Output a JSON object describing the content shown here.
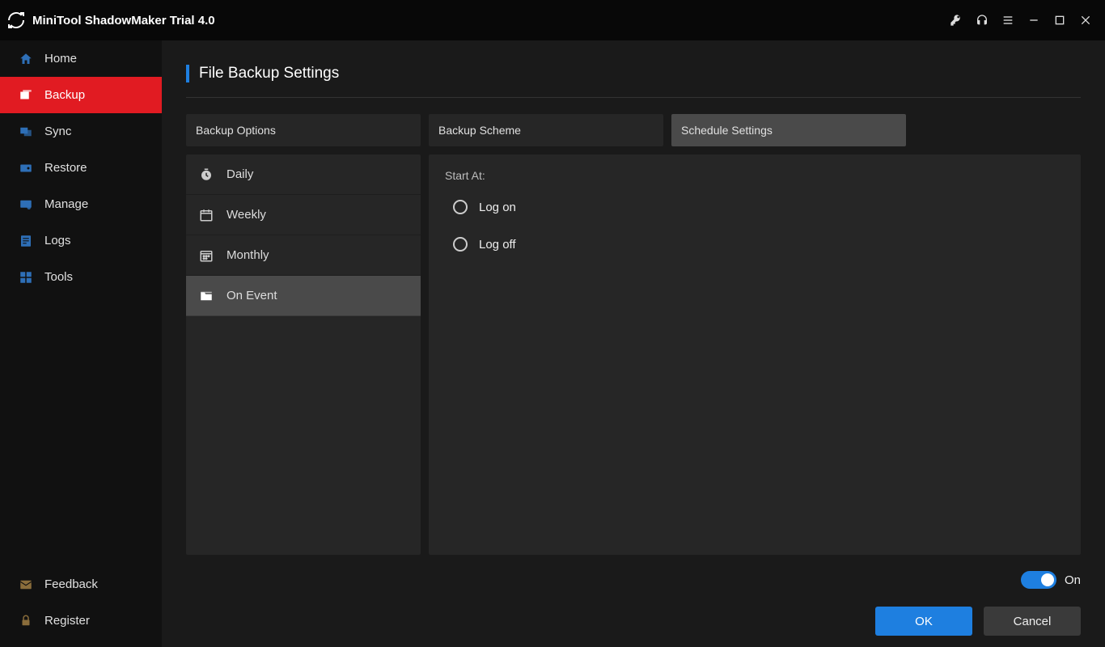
{
  "app": {
    "title": "MiniTool ShadowMaker Trial 4.0"
  },
  "sidebar": {
    "items": [
      {
        "label": "Home"
      },
      {
        "label": "Backup"
      },
      {
        "label": "Sync"
      },
      {
        "label": "Restore"
      },
      {
        "label": "Manage"
      },
      {
        "label": "Logs"
      },
      {
        "label": "Tools"
      }
    ],
    "bottom": [
      {
        "label": "Feedback"
      },
      {
        "label": "Register"
      }
    ]
  },
  "page": {
    "title": "File Backup Settings"
  },
  "tabs": [
    {
      "label": "Backup Options"
    },
    {
      "label": "Backup Scheme"
    },
    {
      "label": "Schedule Settings"
    }
  ],
  "schedule": {
    "options": [
      {
        "label": "Daily"
      },
      {
        "label": "Weekly"
      },
      {
        "label": "Monthly"
      },
      {
        "label": "On Event"
      }
    ],
    "section_label": "Start At:",
    "events": [
      {
        "label": "Log on"
      },
      {
        "label": "Log off"
      }
    ]
  },
  "footer": {
    "toggle_label": "On",
    "ok": "OK",
    "cancel": "Cancel"
  }
}
